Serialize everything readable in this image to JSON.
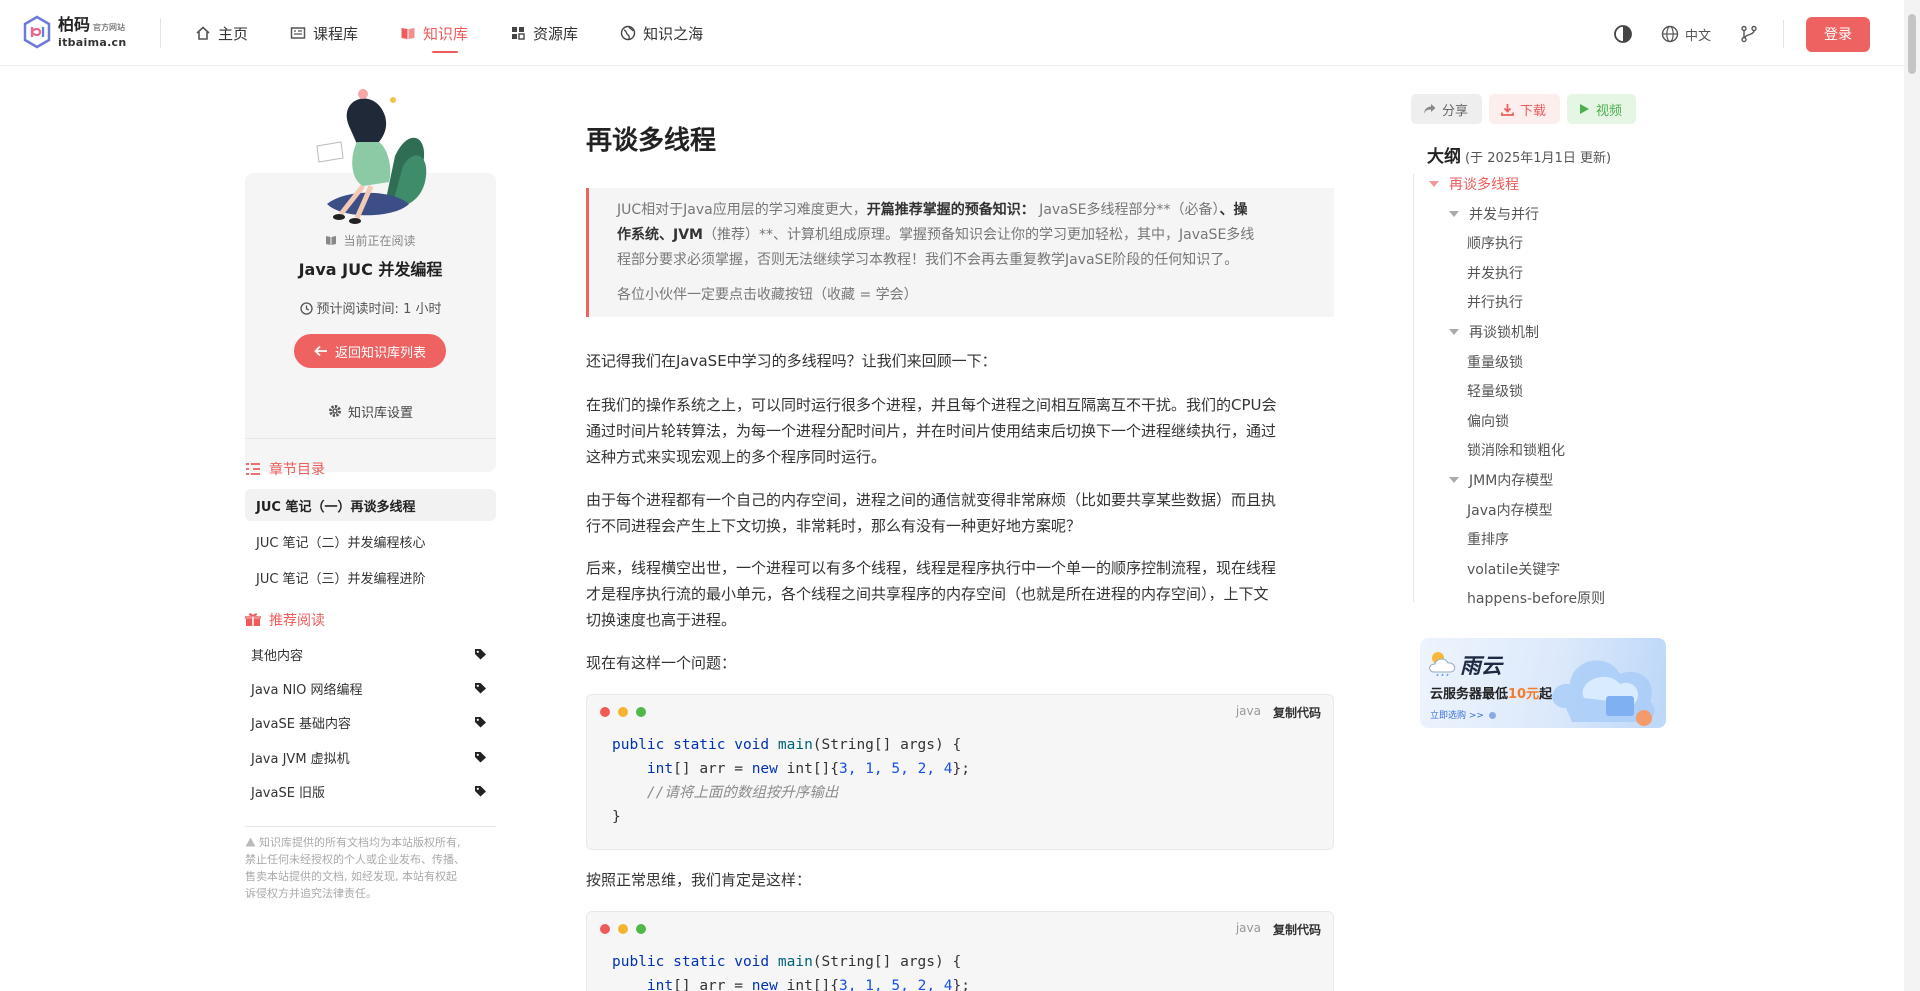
{
  "header": {
    "logo_main": "柏码",
    "logo_sub": "官方网站",
    "logo_url": "itbaima.cn",
    "nav": [
      {
        "label": "主页",
        "icon": "home-icon",
        "active": false
      },
      {
        "label": "课程库",
        "icon": "course-icon",
        "active": false
      },
      {
        "label": "知识库",
        "icon": "book-icon",
        "active": true
      },
      {
        "label": "资源库",
        "icon": "grid-icon",
        "active": false
      },
      {
        "label": "知识之海",
        "icon": "globe-icon",
        "active": false
      }
    ],
    "lang": "中文",
    "login": "登录"
  },
  "left": {
    "reading_now": "当前正在阅读",
    "book_title": "Java JUC 并发编程",
    "read_time_label": "预计阅读时间:",
    "read_time_value": "1 小时",
    "back": "返回知识库列表",
    "settings": "知识库设置",
    "chapters_title": "章节目录",
    "chapters": [
      {
        "label": "JUC 笔记（一）再谈多线程",
        "active": true
      },
      {
        "label": "JUC 笔记（二）并发编程核心",
        "active": false
      },
      {
        "label": "JUC 笔记（三）并发编程进阶",
        "active": false
      }
    ],
    "recommend_title": "推荐阅读",
    "recommend": [
      {
        "label": "其他内容"
      },
      {
        "label": "Java NIO 网络编程"
      },
      {
        "label": "JavaSE 基础内容"
      },
      {
        "label": "Java JVM 虚拟机"
      },
      {
        "label": "JavaSE 旧版"
      }
    ],
    "copyright_lines": [
      "知识库提供的所有文档均为本站版权所有,",
      "禁止任何未经授权的个人或企业发布、传播、",
      "售卖本站提供的文档, 如经发现, 本站有权起",
      "诉侵权方并追究法律责任。"
    ]
  },
  "main": {
    "title": "再谈多线程",
    "quote_lines": [
      "JUC相对于Java应用层的学习难度更大，|开篇推荐掌握的预备知识：| JavaSE多线程部分**（必备）|、操",
      "|作系统、JVM|（推荐）**、计算机组成原理。掌握预备知识会让你的学习更加轻松，其中，JavaSE多线",
      "程部分要求必须掌握，否则无法继续学习本教程！我们不会再去重复教学JavaSE阶段的任何知识了。"
    ],
    "quote_note": "各位小伙伴一定要点击收藏按钮（收藏 = 学会）",
    "paragraphs": [
      [
        "还记得我们在JavaSE中学习的多线程吗？让我们来回顾一下："
      ],
      [
        "在我们的操作系统之上，可以同时运行很多个进程，并且每个进程之间相互隔离互不干扰。我们的CPU会",
        "通过时间片轮转算法，为每一个进程分配时间片，并在时间片使用结束后切换下一个进程继续执行，通过",
        "这种方式来实现宏观上的多个程序同时运行。"
      ],
      [
        "由于每个进程都有一个自己的内存空间，进程之间的通信就变得非常麻烦（比如要共享某些数据）而且执",
        "行不同进程会产生上下文切换，非常耗时，那么有没有一种更好地方案呢？"
      ],
      [
        "后来，线程横空出世，一个进程可以有多个线程，线程是程序执行中一个单一的顺序控制流程，现在线程",
        "才是程序执行流的最小单元，各个线程之间共享程序的内存空间（也就是所在进程的内存空间），上下文",
        "切换速度也高于进程。"
      ],
      [
        "现在有这样一个问题："
      ],
      [
        "按照正常思维，我们肯定是这样："
      ]
    ],
    "code_lang": "java",
    "code_copy": "复制代码",
    "code1": {
      "l1_kw": "public static void",
      "l1_fn": "main",
      "l1_rest": "(String[] args) {",
      "l2_a": "int",
      "l2_b": "[] arr = ",
      "l2_kw": "new",
      "l2_c": " int[]{",
      "l2_nums": "3, 1, 5, 2, 4",
      "l2_d": "};",
      "l3_comment": "//请将上面的数组按升序输出",
      "l4": "}"
    },
    "code2": {
      "l1_kw": "public static void",
      "l1_fn": "main",
      "l1_rest": "(String[] args) {",
      "l2_a": "int",
      "l2_b": "[] arr = ",
      "l2_kw": "new",
      "l2_c": " int[]{",
      "l2_nums": "3, 1, 5, 2, 4",
      "l2_d": "};"
    }
  },
  "right": {
    "share": "分享",
    "download": "下载",
    "video": "视频",
    "outline_title": "大纲",
    "outline_date": "(于 2025年1月1日 更新)",
    "outline": [
      {
        "label": "再谈多线程",
        "level": 0,
        "tri": true,
        "active": true
      },
      {
        "label": "并发与并行",
        "level": 1,
        "tri": true,
        "active": false
      },
      {
        "label": "顺序执行",
        "level": 2,
        "tri": false,
        "active": false
      },
      {
        "label": "并发执行",
        "level": 2,
        "tri": false,
        "active": false
      },
      {
        "label": "并行执行",
        "level": 2,
        "tri": false,
        "active": false
      },
      {
        "label": "再谈锁机制",
        "level": 1,
        "tri": true,
        "active": false
      },
      {
        "label": "重量级锁",
        "level": 2,
        "tri": false,
        "active": false
      },
      {
        "label": "轻量级锁",
        "level": 2,
        "tri": false,
        "active": false
      },
      {
        "label": "偏向锁",
        "level": 2,
        "tri": false,
        "active": false
      },
      {
        "label": "锁消除和锁粗化",
        "level": 2,
        "tri": false,
        "active": false
      },
      {
        "label": "JMM内存模型",
        "level": 1,
        "tri": true,
        "active": false
      },
      {
        "label": "Java内存模型",
        "level": 2,
        "tri": false,
        "active": false
      },
      {
        "label": "重排序",
        "level": 2,
        "tri": false,
        "active": false
      },
      {
        "label": "volatile关键字",
        "level": 2,
        "tri": false,
        "active": false
      },
      {
        "label": "happens-before原则",
        "level": 2,
        "tri": false,
        "active": false
      }
    ],
    "ad": {
      "title": "雨云",
      "sub_prefix": "云服务器最低",
      "sub_price": "10元",
      "sub_suffix": "起",
      "link": "立即选购 >>"
    }
  },
  "colors": {
    "accent": "#ef5b5b",
    "button": "#ef6262"
  }
}
